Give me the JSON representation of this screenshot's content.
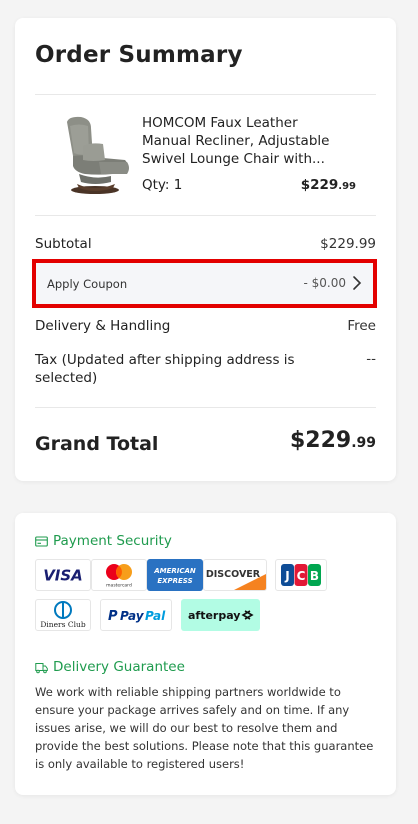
{
  "order_summary": {
    "title": "Order Summary",
    "product": {
      "image_icon": "recliner-chair-image",
      "name": "HOMCOM Faux Leather Manual Recliner, Adjustable Swivel Lounge Chair with...",
      "qty": "Qty: 1",
      "price_main": "$229",
      "price_cents": ".99"
    },
    "subtotal_label": "Subtotal",
    "subtotal_value": "$229.99",
    "coupon_label": "Apply Coupon",
    "coupon_value": "- $0.00",
    "delivery_label": "Delivery & Handling",
    "delivery_value": "Free",
    "tax_label": "Tax (Updated after shipping address is selected)",
    "tax_value": "--",
    "grand_total_label": "Grand Total",
    "grand_total_main": "$229",
    "grand_total_cents": ".99",
    "highlight_color": "#e30000"
  },
  "payment_security": {
    "heading": "Payment Security",
    "heading_color": "#1f9b4e",
    "logos": [
      {
        "name": "visa-logo",
        "text": "VISA"
      },
      {
        "name": "mastercard-logo",
        "text": "mastercard"
      },
      {
        "name": "amex-logo",
        "text": "AMERICAN EXPRESS"
      },
      {
        "name": "discover-logo",
        "text": "DISCOVER"
      },
      {
        "name": "jcb-logo",
        "text": "JCB"
      },
      {
        "name": "diners-club-logo",
        "text": "Diners Club"
      },
      {
        "name": "paypal-logo",
        "text": "PayPal"
      },
      {
        "name": "afterpay-logo",
        "text": "afterpay"
      }
    ]
  },
  "delivery_guarantee": {
    "heading": "Delivery Guarantee",
    "text": "We work with reliable shipping partners worldwide to ensure your package arrives safely and on time. If any issues arise, we will do our best to resolve them and provide the best solutions. Please note that this guarantee is only available to registered users!"
  }
}
